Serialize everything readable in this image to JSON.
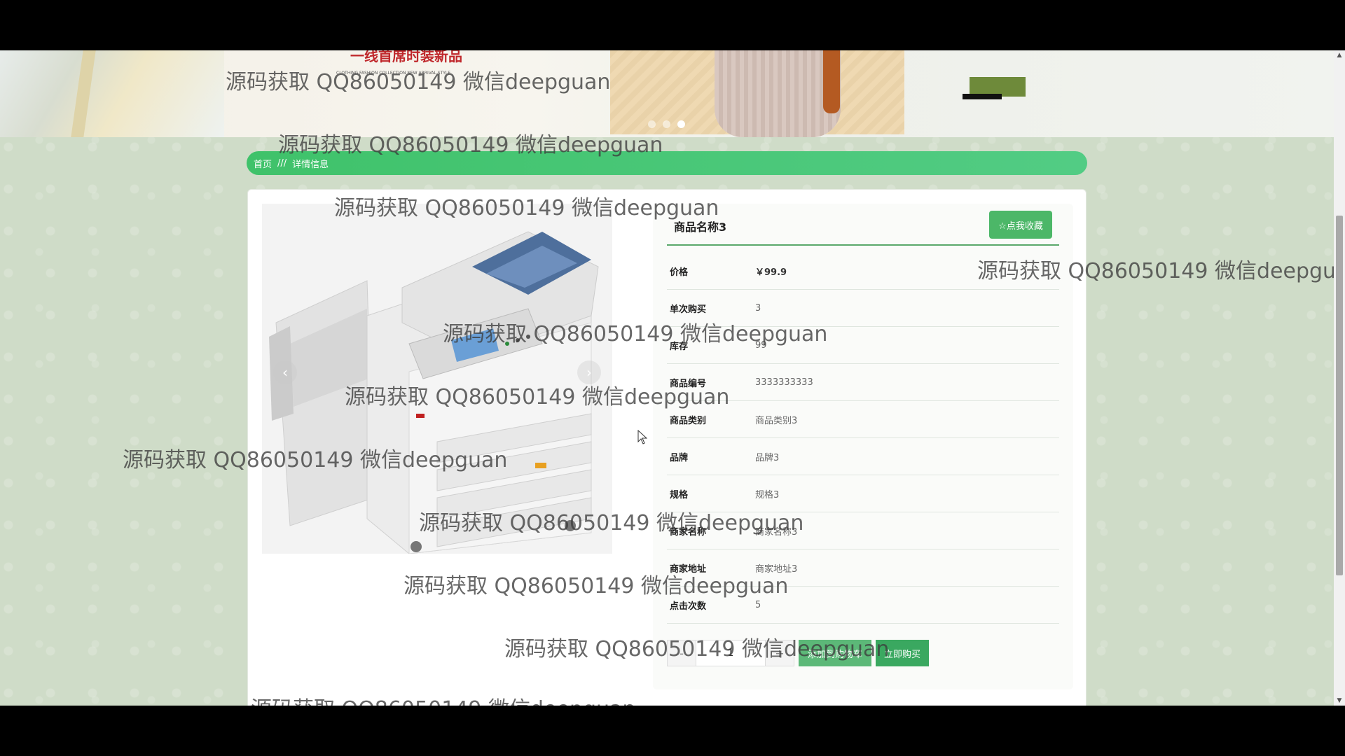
{
  "banner": {
    "red_headline": "一线首席时装新品",
    "tiny_text": "CLOTHING FASHION COLLECTION NEW ARRIVAL STYLE",
    "carousel_dots": 3,
    "active_dot": 2
  },
  "breadcrumb": {
    "home": "首页",
    "separator": "///",
    "current": "详情信息"
  },
  "product": {
    "title": "商品名称3",
    "favorite_label": "☆点我收藏",
    "image_icon": "printer-copier-image",
    "fields": [
      {
        "label": "价格",
        "value": "￥99.9"
      },
      {
        "label": "单次购买",
        "value": "3"
      },
      {
        "label": "库存",
        "value": "99"
      },
      {
        "label": "商品编号",
        "value": "3333333333"
      },
      {
        "label": "商品类别",
        "value": "商品类别3"
      },
      {
        "label": "品牌",
        "value": "品牌3"
      },
      {
        "label": "规格",
        "value": "规格3"
      },
      {
        "label": "商家名称",
        "value": "商家名称3"
      },
      {
        "label": "商家地址",
        "value": "商家地址3"
      },
      {
        "label": "点击次数",
        "value": "5"
      }
    ],
    "quantity": "1",
    "minus_label": "-",
    "plus_label": "+",
    "add_to_cart": "添加到购物车",
    "buy_now": "立即购买"
  },
  "gallery": {
    "prev": "‹",
    "next": "›"
  },
  "watermark": {
    "text": "源码获取 QQ86050149 微信deepguan"
  },
  "colors": {
    "accent": "#4cb768",
    "breadcrumb": "#46c474",
    "page_bg": "#cfdcc8"
  }
}
